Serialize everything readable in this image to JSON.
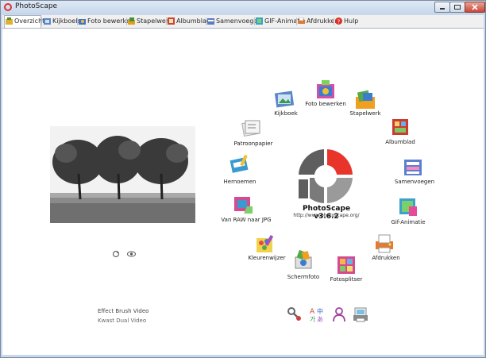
{
  "window": {
    "title": "PhotoScape"
  },
  "tabs": [
    {
      "label": "Overzicht",
      "active": true
    },
    {
      "label": "Kijkboek"
    },
    {
      "label": "Foto bewerken"
    },
    {
      "label": "Stapelwerk"
    },
    {
      "label": "Afdrukken",
      "note": ""
    },
    {
      "label": "Samenvoegen"
    },
    {
      "label": "GIF-Animatie"
    },
    {
      "label": "Afdrukken"
    },
    {
      "label": "Hulp"
    }
  ],
  "bottom_menu": {
    "line1": "Effect Brush Video",
    "line2": "Kwast Dual Video"
  },
  "brand": {
    "name": "PhotoScape v3.6.2",
    "url": "http://www.photoscape.org/"
  },
  "modules": [
    {
      "label": "Foto bewerken"
    },
    {
      "label": "Stapelwerk"
    },
    {
      "label": "Albumblad"
    },
    {
      "label": "Samenvoegen"
    },
    {
      "label": "Gif-Animatie"
    },
    {
      "label": "Afdrukken"
    },
    {
      "label": "Fotosplitser"
    },
    {
      "label": "Schermfoto"
    },
    {
      "label": "Kleurenwijzer"
    },
    {
      "label": "Van RAW naar JPG"
    },
    {
      "label": "Hernoemen"
    },
    {
      "label": "Patroonpapier"
    },
    {
      "label": "Kijkboek"
    }
  ],
  "colors": {
    "accent_red": "#e8342a",
    "logo_gray": "#8a8a8a",
    "chrome": "#c9d8eb"
  }
}
